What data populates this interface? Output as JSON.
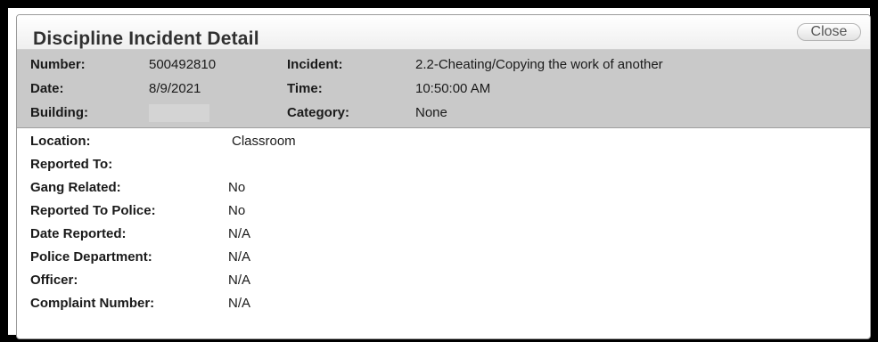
{
  "dialog": {
    "title": "Discipline Incident Detail",
    "close_label": "Close"
  },
  "summary": {
    "number_label": "Number:",
    "number_value": "500492810",
    "incident_label": "Incident:",
    "incident_value": "2.2-Cheating/Copying the work of another",
    "date_label": "Date:",
    "date_value": "8/9/2021",
    "time_label": "Time:",
    "time_value": "10:50:00 AM",
    "building_label": "Building:",
    "building_value": "",
    "category_label": "Category:",
    "category_value": "None"
  },
  "details": [
    {
      "label": "Location:",
      "value": "Classroom"
    },
    {
      "label": "Reported To:",
      "value": ""
    },
    {
      "label": "Gang Related:",
      "value": "No"
    },
    {
      "label": "Reported To Police:",
      "value": "No"
    },
    {
      "label": "Date Reported:",
      "value": "N/A"
    },
    {
      "label": "Police Department:",
      "value": "N/A"
    },
    {
      "label": "Officer:",
      "value": "N/A"
    },
    {
      "label": "Complaint Number:",
      "value": "N/A"
    }
  ],
  "colors": {
    "summary_background": "#c9c9c9",
    "outer_border": "#000000"
  }
}
